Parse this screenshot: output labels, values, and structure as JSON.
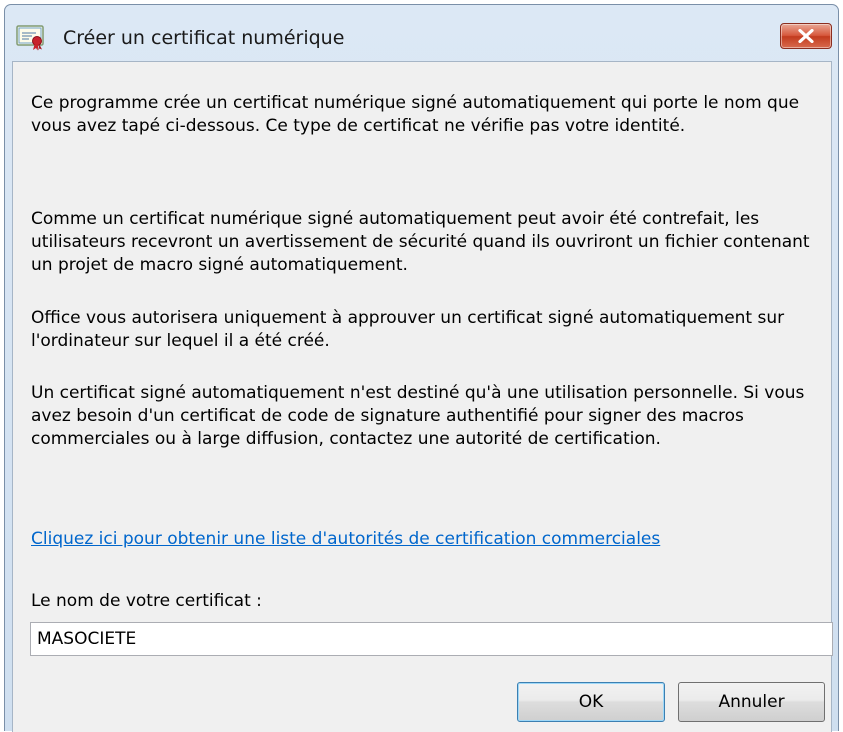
{
  "window": {
    "title": "Créer un certificat numérique"
  },
  "icons": {
    "app": "certificate-icon",
    "close": "close-icon"
  },
  "content": {
    "paragraphs": [
      "Ce programme crée un certificat numérique signé automatiquement qui porte le nom que vous avez tapé ci-dessous. Ce type de certificat ne vérifie pas votre identité.",
      "Comme un certificat numérique signé automatiquement peut avoir été contrefait, les utilisateurs recevront un avertissement de sécurité quand ils ouvriront un fichier contenant un projet de macro signé automatiquement.",
      "Office vous autorisera uniquement à approuver un certificat signé automatiquement sur l'ordinateur sur lequel il a été créé.",
      "Un certificat signé automatiquement n'est destiné qu'à une utilisation personnelle. Si vous avez besoin d'un certificat de code de signature authentifié pour signer des macros commerciales ou à large diffusion, contactez une autorité de certification."
    ],
    "link_text": "Cliquez ici pour obtenir une liste d'autorités de certification commerciales",
    "field_label": "Le nom de votre certificat :",
    "field_value": "MASOCIETE"
  },
  "buttons": {
    "ok": "OK",
    "cancel": "Annuler"
  },
  "colors": {
    "link": "#0066cc",
    "close_button": "#c7432a",
    "dialog_background": "#f0f0f0"
  }
}
